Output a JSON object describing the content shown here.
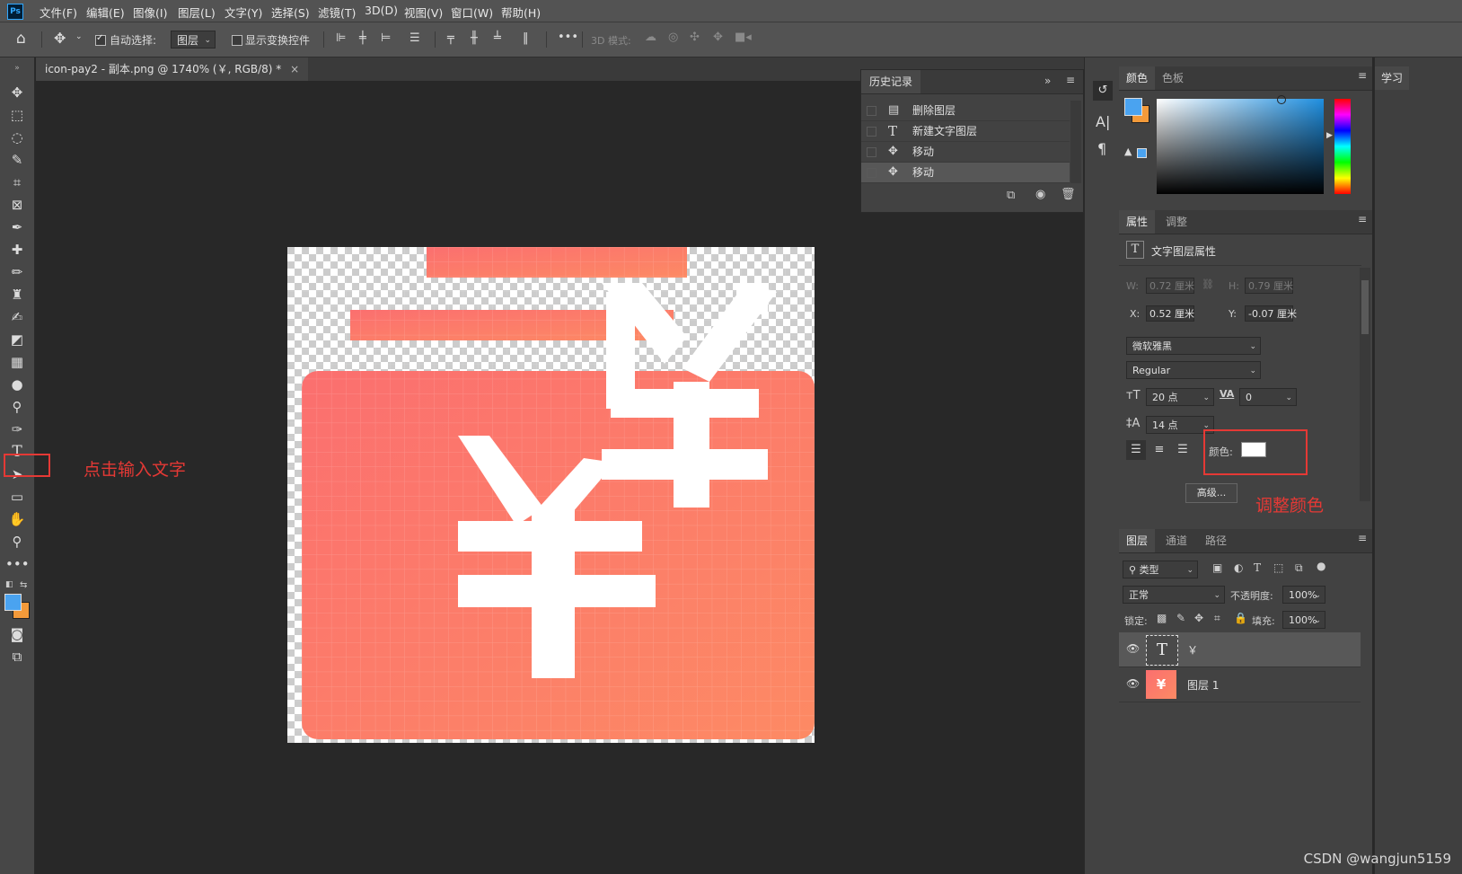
{
  "app": {
    "logo": "Ps"
  },
  "menu": [
    "文件(F)",
    "编辑(E)",
    "图像(I)",
    "图层(L)",
    "文字(Y)",
    "选择(S)",
    "滤镜(T)",
    "3D(D)",
    "视图(V)",
    "窗口(W)",
    "帮助(H)"
  ],
  "options": {
    "auto_select_label": "自动选择:",
    "auto_select_value": "图层",
    "show_transform_label": "显示变换控件",
    "more": "•••",
    "mode_3d_label": "3D 模式:"
  },
  "document_tab": {
    "title": "icon-pay2 - 副本.png @ 1740% (￥, RGB/8) *",
    "close": "×"
  },
  "history": {
    "tab": "历史记录",
    "items": [
      {
        "icon": "document-icon",
        "glyph": "▤",
        "label": "删除图层"
      },
      {
        "icon": "type-icon",
        "glyph": "T",
        "label": "新建文字图层"
      },
      {
        "icon": "move-icon",
        "glyph": "✥",
        "label": "移动"
      },
      {
        "icon": "move-icon",
        "glyph": "✥",
        "label": "移动"
      }
    ]
  },
  "color_panel": {
    "tabs": [
      "颜色",
      "色板"
    ],
    "foreground": "#4aa3f0",
    "background": "#f39a3a"
  },
  "learn_panel": {
    "tab": "学习"
  },
  "properties": {
    "tabs": [
      "属性",
      "调整"
    ],
    "title": "文字图层属性",
    "w_label": "W:",
    "w_value": "0.72 厘米",
    "h_label": "H:",
    "h_value": "0.79 厘米",
    "x_label": "X:",
    "x_value": "0.52 厘米",
    "y_label": "Y:",
    "y_value": "-0.07 厘米",
    "font_family": "微软雅黑",
    "font_style": "Regular",
    "font_size": "20 点",
    "tracking": "0",
    "leading": "14 点",
    "color_label": "颜色:",
    "text_color": "#ffffff",
    "advanced": "高级..."
  },
  "layers": {
    "tabs": [
      "图层",
      "通道",
      "路径"
    ],
    "filter_kind": "类型",
    "blend_mode": "正常",
    "opacity_label": "不透明度:",
    "opacity_value": "100%",
    "lock_label": "锁定:",
    "fill_label": "填充:",
    "fill_value": "100%",
    "items": [
      {
        "name": "￥",
        "type": "text"
      },
      {
        "name": "图层 1",
        "type": "pixel"
      }
    ]
  },
  "annotations": {
    "type_tool": "点击输入文字",
    "color": "调整颜色"
  },
  "watermark": "CSDN @wangjun5159"
}
